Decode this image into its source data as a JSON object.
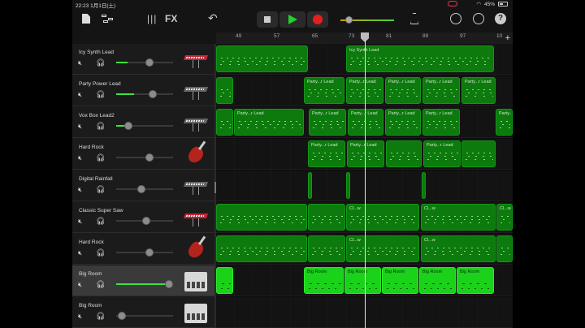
{
  "status": {
    "time": "22:23",
    "date": "1月1日(土)",
    "battery": "45%"
  },
  "toolbar": {
    "fx_label": "FX",
    "mixer_label": "|||"
  },
  "ruler": {
    "bars": [
      "49",
      "57",
      "65",
      "73",
      "81",
      "89",
      "97",
      "10"
    ],
    "add_label": "+"
  },
  "tracks": [
    {
      "name": "Icy Synth Lead",
      "instrument": "synth-keyboard-icon",
      "volume": 0.5
    },
    {
      "name": "Party Power Lead",
      "instrument": "keyboard-icon",
      "volume": 0.55
    },
    {
      "name": "Vox Box Lead2",
      "instrument": "keyboard-icon",
      "volume": 0.2
    },
    {
      "name": "Hard Rock",
      "instrument": "guitar-icon",
      "volume": 0.5
    },
    {
      "name": "Digital Rainfall",
      "instrument": "keyboard-icon",
      "volume": 0.4
    },
    {
      "name": "Classic Super Saw",
      "instrument": "synth-keyboard-icon",
      "volume": 0.45
    },
    {
      "name": "Hard Rock",
      "instrument": "guitar-icon",
      "volume": 0.5
    },
    {
      "name": "Big Room",
      "instrument": "drum-machine-icon",
      "volume": 0.9
    },
    {
      "name": "Big Room",
      "instrument": "drum-machine-icon",
      "volume": 0.08
    }
  ],
  "regions": {
    "icy": "Icy Synth Lead",
    "party": "Party...r Lead",
    "cl": "Cl...w",
    "big": "Big Room"
  }
}
